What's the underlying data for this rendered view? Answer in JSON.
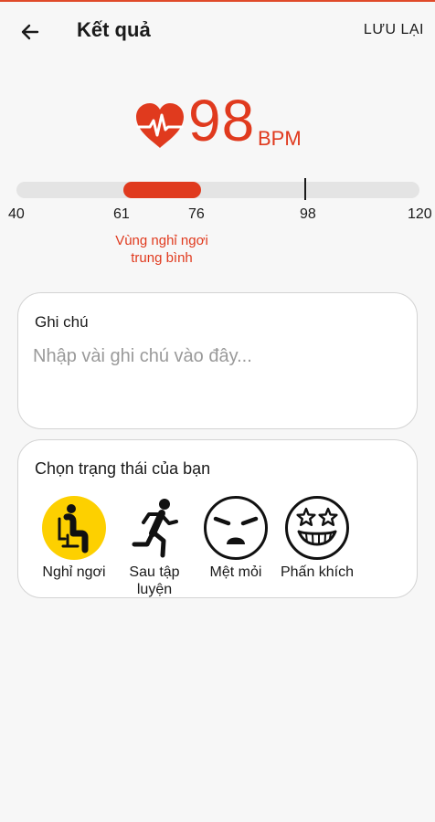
{
  "app_bar": {
    "title": "Kết quả",
    "save_label": "LƯU LẠI"
  },
  "heart_rate": {
    "value": "98",
    "unit": "BPM"
  },
  "range": {
    "min": 40,
    "max": 120,
    "zone_start": 61,
    "zone_end": 76,
    "current": 98,
    "ticks": [
      "40",
      "61",
      "76",
      "98",
      "120"
    ],
    "zone_label": "Vùng nghỉ ngơi trung bình"
  },
  "notes": {
    "title": "Ghi chú",
    "placeholder": "Nhập vài ghi chú vào đây...",
    "value": ""
  },
  "status": {
    "title": "Chọn trạng thái của bạn",
    "options": [
      {
        "label": "Nghỉ ngơi",
        "icon": "sitting-person-icon",
        "selected": true
      },
      {
        "label": "Sau tập luyện",
        "icon": "running-person-icon",
        "selected": false
      },
      {
        "label": "Mệt mỏi",
        "icon": "tired-face-icon",
        "selected": false
      },
      {
        "label": "Phấn khích",
        "icon": "star-eyes-face-icon",
        "selected": false
      }
    ]
  },
  "colors": {
    "accent": "#e03a1e",
    "selected_status": "#fdd000",
    "track": "#e4e4e4"
  }
}
